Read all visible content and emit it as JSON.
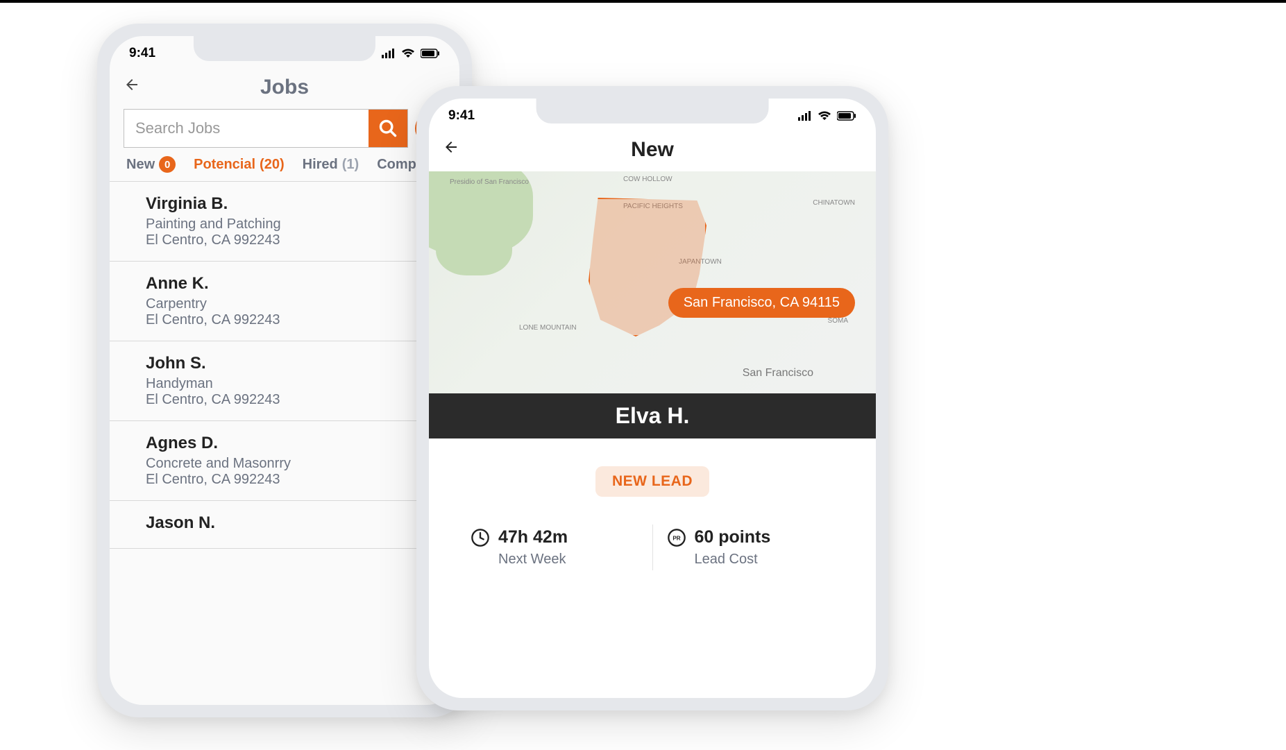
{
  "status": {
    "time": "9:41"
  },
  "phone1": {
    "title": "Jobs",
    "search_placeholder": "Search Jobs",
    "tabs": [
      {
        "label": "New",
        "count": "0",
        "badge": true
      },
      {
        "label": "Potencial",
        "count": "(20)",
        "active": true
      },
      {
        "label": "Hired",
        "count": "(1)"
      },
      {
        "label": "Complete"
      }
    ],
    "jobs": [
      {
        "name": "Virginia B.",
        "category": "Painting and Patching",
        "location": "El Centro, CA 992243"
      },
      {
        "name": "Anne K.",
        "category": "Carpentry",
        "location": "El Centro, CA 992243"
      },
      {
        "name": "John S.",
        "category": "Handyman",
        "location": "El Centro, CA 992243"
      },
      {
        "name": "Agnes D.",
        "category": "Concrete and Masonrry",
        "location": "El Centro, CA 992243"
      },
      {
        "name": "Jason N.",
        "category": "",
        "location": ""
      }
    ]
  },
  "phone2": {
    "title": "New",
    "map": {
      "location_label": "San Francisco, CA 94115",
      "place_labels": [
        "Presidio of San Francisco",
        "COW HOLLOW",
        "PACIFIC HEIGHTS",
        "JAPANTOWN",
        "LONE MOUNTAIN",
        "CHINATOWN",
        "SOMA",
        "San Francisco"
      ]
    },
    "customer_name": "Elva H.",
    "lead_badge": "NEW LEAD",
    "stats": {
      "time_value": "47h 42m",
      "time_label": "Next Week",
      "cost_value": "60 points",
      "cost_label": "Lead Cost"
    }
  }
}
